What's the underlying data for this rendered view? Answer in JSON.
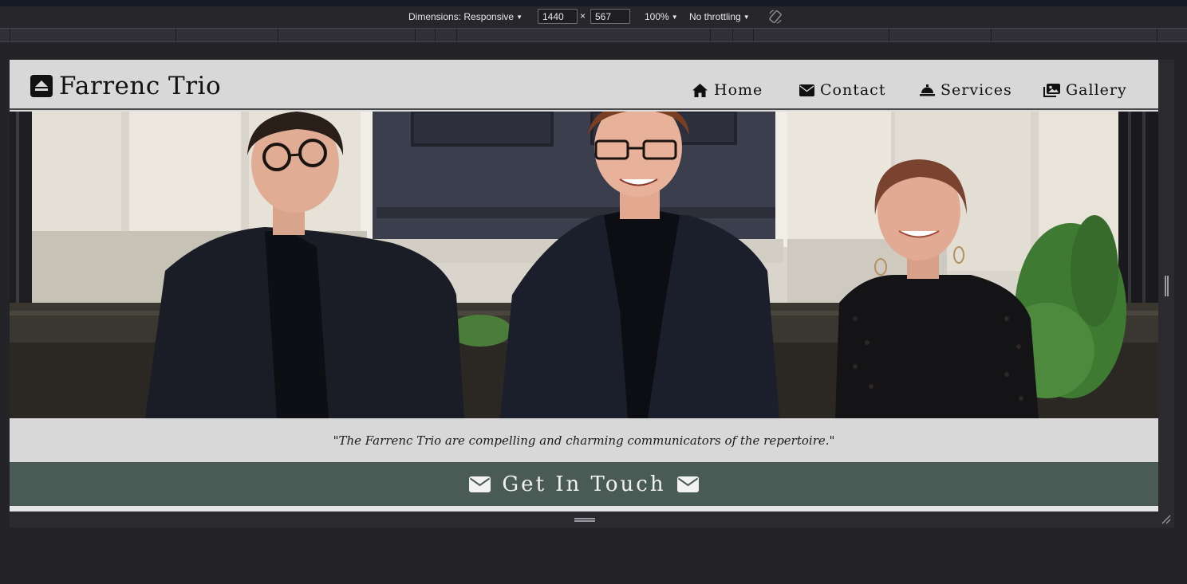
{
  "devtools": {
    "dimensions_label": "Dimensions: Responsive",
    "width_value": "1440",
    "height_value": "567",
    "times_symbol": "×",
    "zoom": "100%",
    "throttling": "No throttling",
    "rotate_icon": "rotate-icon"
  },
  "site": {
    "brand": {
      "name": "Farrenc Trio",
      "icon": "eject-square-icon"
    },
    "nav": [
      {
        "label": "Home",
        "icon": "home-icon"
      },
      {
        "label": "Contact",
        "icon": "envelope-icon"
      },
      {
        "label": "Services",
        "icon": "concierge-bell-icon"
      },
      {
        "label": "Gallery",
        "icon": "images-icon"
      }
    ],
    "hero": {
      "description_icon": "trio-photo"
    },
    "quote": "\"The Farrenc Trio are compelling and charming communicators of the repertoire.\"",
    "cta": {
      "label": "Get In Touch",
      "icon": "envelope-icon"
    }
  },
  "colors": {
    "nav_bg": "#d8d8d8",
    "cta_bg": "#4a5a54",
    "text_dark": "#111111",
    "devtools_bg": "#26262b"
  }
}
